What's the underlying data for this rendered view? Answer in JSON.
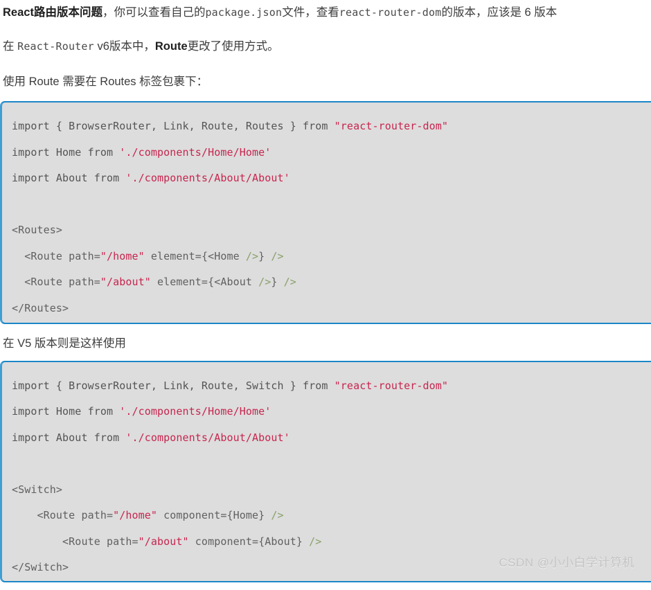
{
  "article": {
    "paragraph_1": {
      "bold_lead": "React路由版本问题",
      "text_a": "，你可以查看自己的",
      "code_a": "package.json",
      "text_b": "文件，查看",
      "code_b": "react-router-dom",
      "text_c": "的版本，应该是 6 版本"
    },
    "paragraph_2": {
      "text_a": "在 ",
      "code_a": "React-Router",
      "text_b": " v6版本中，",
      "emph": "Route",
      "text_c": "更改了使用方式。"
    },
    "paragraph_3": {
      "text": "使用 Route 需要在 Routes 标签包裹下："
    },
    "paragraph_4": {
      "text": "在 V5 版本则是这样使用"
    }
  },
  "code_block_v6": {
    "language": "jsx",
    "lines": [
      [
        {
          "t": "plain",
          "v": "import { BrowserRouter, Link, Route, Routes } from "
        },
        {
          "t": "str",
          "v": "\"react-router-dom\""
        }
      ],
      [
        {
          "t": "plain",
          "v": "import Home from "
        },
        {
          "t": "str",
          "v": "'./components/Home/Home'"
        }
      ],
      [
        {
          "t": "plain",
          "v": "import About from "
        },
        {
          "t": "str",
          "v": "'./components/About/About'"
        }
      ],
      [
        {
          "t": "plain",
          "v": ""
        }
      ],
      [
        {
          "t": "tag",
          "v": "<Routes>"
        }
      ],
      [
        {
          "t": "tag",
          "v": "  <Route path="
        },
        {
          "t": "str",
          "v": "\"/home\""
        },
        {
          "t": "tag",
          "v": " element={<Home "
        },
        {
          "t": "close",
          "v": "/>"
        },
        {
          "t": "tag",
          "v": "} "
        },
        {
          "t": "close",
          "v": "/>"
        }
      ],
      [
        {
          "t": "tag",
          "v": "  <Route path="
        },
        {
          "t": "str",
          "v": "\"/about\""
        },
        {
          "t": "tag",
          "v": " element={<About "
        },
        {
          "t": "close",
          "v": "/>"
        },
        {
          "t": "tag",
          "v": "} "
        },
        {
          "t": "close",
          "v": "/>"
        }
      ],
      [
        {
          "t": "tag",
          "v": "</Routes>"
        }
      ]
    ]
  },
  "code_block_v5": {
    "language": "jsx",
    "lines": [
      [
        {
          "t": "plain",
          "v": "import { BrowserRouter, Link, Route, Switch } from "
        },
        {
          "t": "str",
          "v": "\"react-router-dom\""
        }
      ],
      [
        {
          "t": "plain",
          "v": "import Home from "
        },
        {
          "t": "str",
          "v": "'./components/Home/Home'"
        }
      ],
      [
        {
          "t": "plain",
          "v": "import About from "
        },
        {
          "t": "str",
          "v": "'./components/About/About'"
        }
      ],
      [
        {
          "t": "plain",
          "v": ""
        }
      ],
      [
        {
          "t": "tag",
          "v": "<Switch>"
        }
      ],
      [
        {
          "t": "tag",
          "v": "    <Route path="
        },
        {
          "t": "str",
          "v": "\"/home\""
        },
        {
          "t": "tag",
          "v": " component={Home} "
        },
        {
          "t": "close",
          "v": "/>"
        }
      ],
      [
        {
          "t": "tag",
          "v": "        <Route path="
        },
        {
          "t": "str",
          "v": "\"/about\""
        },
        {
          "t": "tag",
          "v": " component={About} "
        },
        {
          "t": "close",
          "v": "/>"
        }
      ],
      [
        {
          "t": "tag",
          "v": "</Switch>"
        }
      ]
    ]
  },
  "watermark": {
    "text": "CSDN @小小白学计算机"
  },
  "colors": {
    "code_background": "#dddddd",
    "code_border_accent": "#1b86c8",
    "string_literal": "#c7254e",
    "jsx_selfclose": "#8aa06b",
    "body_text": "#3c3c3c",
    "watermark": "#c4c4c4"
  }
}
